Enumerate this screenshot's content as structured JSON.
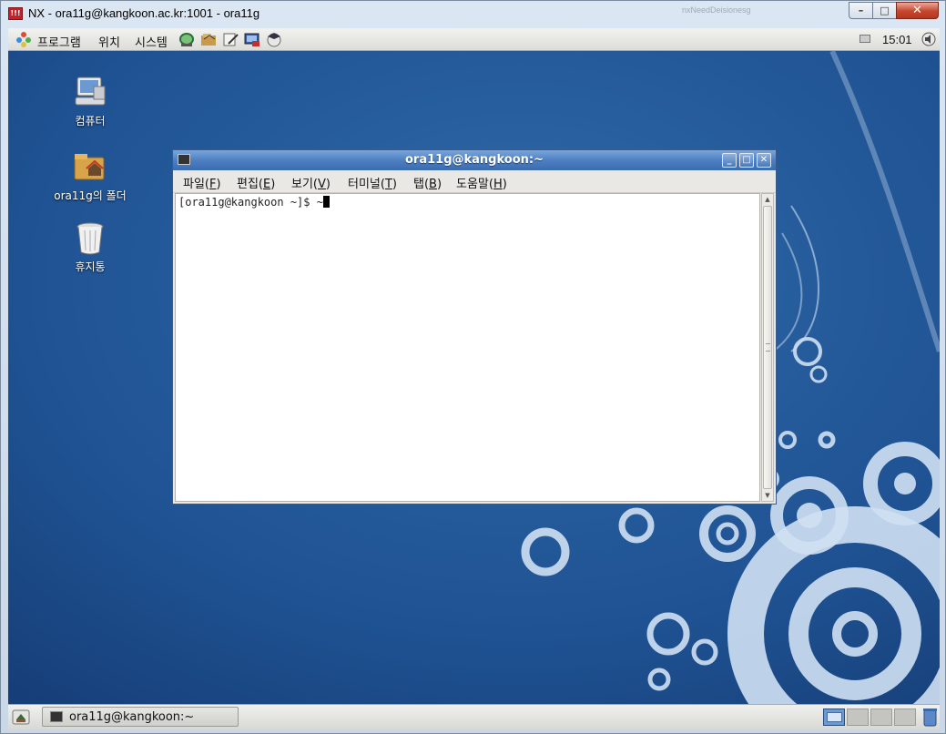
{
  "window": {
    "title": "NX - ora11g@kangkoon.ac.kr:1001 - ora11g",
    "icon": "nx-icon",
    "ghost_text": "nxNeedDeisionesg",
    "controls": {
      "minimize": "–",
      "maximize": "□",
      "close": "✕"
    }
  },
  "top_panel": {
    "menus": [
      {
        "label": "프로그램",
        "icon": "applications-icon"
      },
      {
        "label": "위치"
      },
      {
        "label": "시스템"
      }
    ],
    "launchers": [
      "network-browser-icon",
      "file-browser-icon",
      "text-editor-icon",
      "screenshot-icon",
      "help-icon"
    ],
    "clock": "15:01"
  },
  "desktop_icons": [
    {
      "label": "컴퓨터",
      "icon": "computer-icon"
    },
    {
      "label": "ora11g의 폴더",
      "icon": "home-folder-icon"
    },
    {
      "label": "휴지통",
      "icon": "trash-icon"
    }
  ],
  "terminal": {
    "title": "ora11g@kangkoon:~",
    "menus": [
      "파일(F)",
      "편집(E)",
      "보기(V)",
      "터미널(T)",
      "탭(B)",
      "도움말(H)"
    ],
    "menu_mnemonics": [
      "F",
      "E",
      "V",
      "T",
      "B",
      "H"
    ],
    "prompt": "[ora11g@kangkoon ~]$ ~"
  },
  "bottom_panel": {
    "task": "ora11g@kangkoon:~",
    "workspaces": 4,
    "active_workspace": 1
  },
  "colors": {
    "desktop": "#1e4f8e",
    "titlebar": "#4d7fc2",
    "panel": "#e6e6e3"
  }
}
